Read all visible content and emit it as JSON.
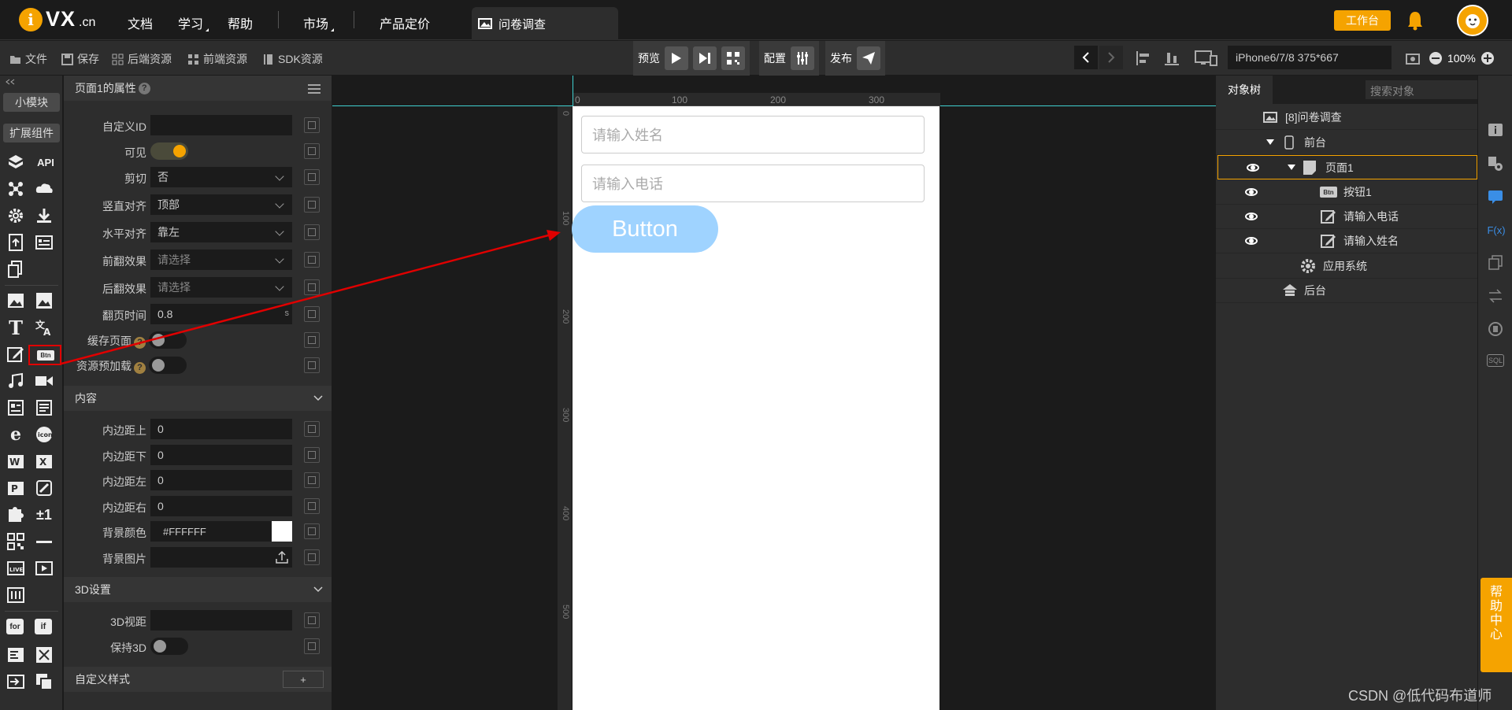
{
  "top": {
    "logo_text": "VX",
    "logo_domain": ".cn",
    "nav": [
      "文档",
      "学习",
      "帮助",
      "市场",
      "产品定价"
    ],
    "doc_tab": "问卷调查",
    "workspace_btn": "工作台"
  },
  "toolbar": {
    "file": "文件",
    "save": "保存",
    "backend": "后端资源",
    "frontend": "前端资源",
    "sdk": "SDK资源",
    "preview": "预览",
    "config": "配置",
    "publish": "发布",
    "device": "iPhone6/7/8 375*667",
    "zoom": "100%"
  },
  "leftbar": {
    "modules": "小模块",
    "extensions": "扩展组件",
    "api": "API",
    "btn_icon": "Btn",
    "plusminus": "±1",
    "for": "for",
    "if": "if"
  },
  "props": {
    "title": "页面1的属性",
    "rows": {
      "custom_id": {
        "label": "自定义ID",
        "value": ""
      },
      "visible": {
        "label": "可见"
      },
      "clip": {
        "label": "剪切",
        "value": "否"
      },
      "valign": {
        "label": "竖直对齐",
        "value": "顶部"
      },
      "halign": {
        "label": "水平对齐",
        "value": "靠左"
      },
      "flip_front": {
        "label": "前翻效果",
        "placeholder": "请选择"
      },
      "flip_back": {
        "label": "后翻效果",
        "placeholder": "请选择"
      },
      "flip_time": {
        "label": "翻页时间",
        "value": "0.8",
        "unit": "s"
      },
      "cache": {
        "label": "缓存页面"
      },
      "preload": {
        "label": "资源预加载"
      }
    },
    "content_section": "内容",
    "padding": {
      "top": {
        "label": "内边距上",
        "value": "0"
      },
      "bottom": {
        "label": "内边距下",
        "value": "0"
      },
      "left": {
        "label": "内边距左",
        "value": "0"
      },
      "right": {
        "label": "内边距右",
        "value": "0"
      }
    },
    "bg_color": {
      "label": "背景颜色",
      "value": "#FFFFFF"
    },
    "bg_image": {
      "label": "背景图片"
    },
    "section_3d": "3D设置",
    "view_3d": {
      "label": "3D视距"
    },
    "keep_3d": {
      "label": "保持3D"
    },
    "custom_style": "自定义样式",
    "add_btn": "+"
  },
  "canvas": {
    "ruler_top": [
      "0",
      "100",
      "200",
      "300"
    ],
    "ruler_left": [
      "0",
      "100",
      "200",
      "300",
      "400",
      "500"
    ],
    "input_name": "请输入姓名",
    "input_phone": "请输入电话",
    "button_text": "Button"
  },
  "tree": {
    "tab": "对象树",
    "search_placeholder": "搜索对象",
    "nodes": [
      {
        "label": "[8]问卷调查"
      },
      {
        "label": "前台"
      },
      {
        "label": "页面1"
      },
      {
        "label": "按钮1",
        "tag": "Btn"
      },
      {
        "label": "请输入电话"
      },
      {
        "label": "请输入姓名"
      },
      {
        "label": "应用系统"
      },
      {
        "label": "后台"
      }
    ]
  },
  "rside": {
    "fx": "F(x)",
    "sql": "SQL"
  },
  "help": "帮助中心",
  "watermark": "CSDN @低代码布道师",
  "colors": {
    "accent": "#f5a300",
    "button": "#9fd3ff",
    "arrow": "#e00000"
  }
}
